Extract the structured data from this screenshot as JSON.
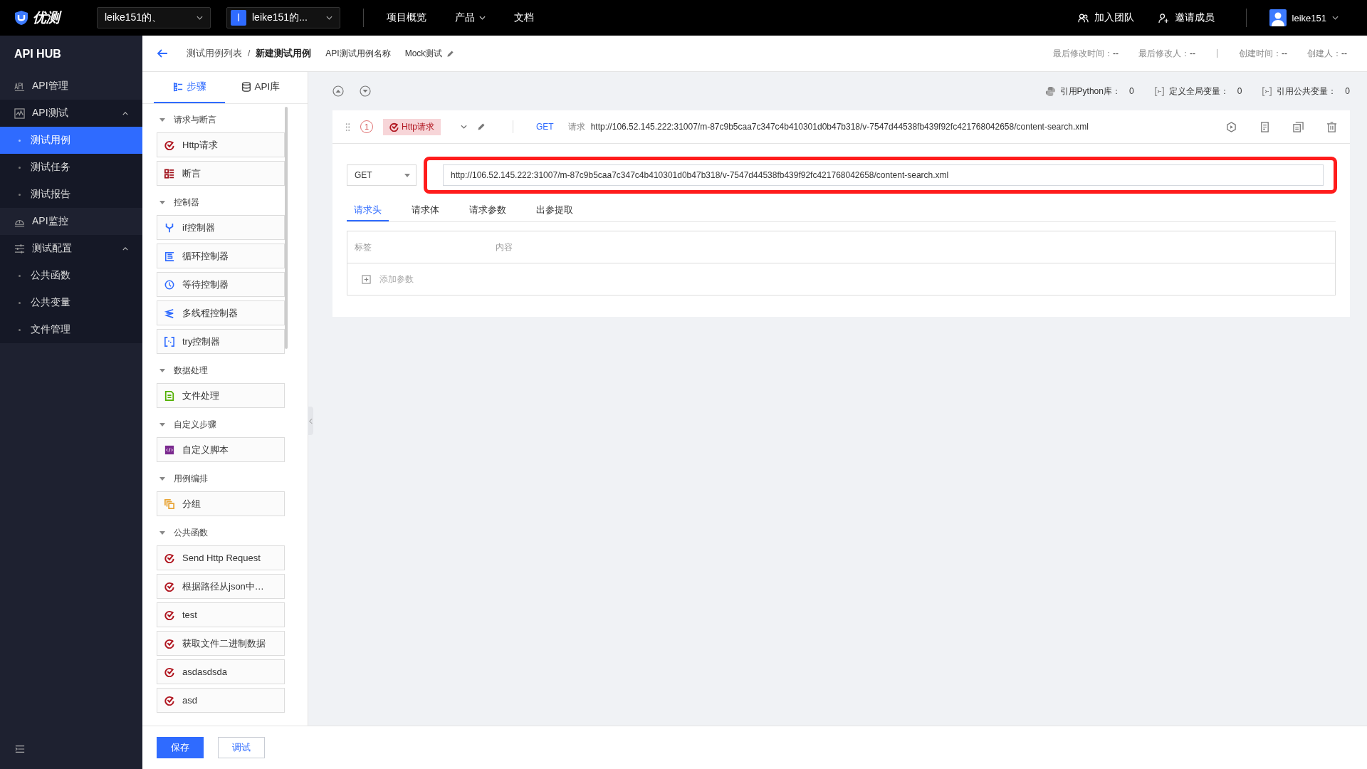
{
  "top_bar": {
    "logo": "优测",
    "team_select": "leike151的、",
    "project_select": {
      "badge": "l",
      "label": "leike151的..."
    },
    "nav": [
      {
        "label": "项目概览",
        "dropdown": false
      },
      {
        "label": "产品",
        "dropdown": true
      },
      {
        "label": "文档",
        "dropdown": false
      }
    ],
    "actions": [
      "加入团队",
      "邀请成员"
    ],
    "user": "leike151"
  },
  "sidebar": {
    "title": "API HUB",
    "items": [
      {
        "label": "API管理",
        "selected": false
      },
      {
        "label": "API测试",
        "selected": false,
        "expanded": true,
        "children": [
          {
            "label": "测试用例",
            "selected": true
          },
          {
            "label": "测试任务",
            "selected": false
          },
          {
            "label": "测试报告",
            "selected": false
          }
        ]
      },
      {
        "label": "API监控",
        "selected": false
      },
      {
        "label": "测试配置",
        "selected": false,
        "expanded": true,
        "children": [
          {
            "label": "公共函数",
            "selected": false
          },
          {
            "label": "公共变量",
            "selected": false
          },
          {
            "label": "文件管理",
            "selected": false
          }
        ]
      }
    ]
  },
  "header": {
    "breadcrumb": [
      "测试用例列表",
      "新建测试用例"
    ],
    "breadcrumb_separator": "/",
    "case_name": "API测试用例名称",
    "tag": "Mock测试",
    "meta": [
      {
        "label": "最后修改时间：",
        "value": "--"
      },
      {
        "label": "最后修改人：",
        "value": "--"
      },
      {
        "label": "创建时间：",
        "value": "--"
      },
      {
        "label": "创建人：",
        "value": "--"
      }
    ]
  },
  "steps_panel": {
    "tabs": [
      {
        "label": "步骤",
        "selected": true
      },
      {
        "label": "API库",
        "selected": false
      }
    ],
    "groups": [
      {
        "title": "请求与断言",
        "expanded": true,
        "items": [
          {
            "label": "Http请求",
            "kind": "http"
          },
          {
            "label": "断言",
            "kind": "assert"
          }
        ]
      },
      {
        "title": "控制器",
        "expanded": true,
        "items": [
          {
            "label": "if控制器",
            "kind": "if"
          },
          {
            "label": "循环控制器",
            "kind": "loop"
          },
          {
            "label": "等待控制器",
            "kind": "wait"
          },
          {
            "label": "多线程控制器",
            "kind": "thread"
          },
          {
            "label": "try控制器",
            "kind": "try"
          }
        ]
      },
      {
        "title": "数据处理",
        "expanded": true,
        "items": [
          {
            "label": "文件处理",
            "kind": "file"
          }
        ]
      },
      {
        "title": "自定义步骤",
        "expanded": true,
        "items": [
          {
            "label": "自定义脚本",
            "kind": "script"
          }
        ]
      },
      {
        "title": "用例编排",
        "expanded": true,
        "items": [
          {
            "label": "分组",
            "kind": "group"
          }
        ]
      },
      {
        "title": "公共函数",
        "expanded": true,
        "items": [
          {
            "label": "Send Http Request",
            "kind": "http"
          },
          {
            "label": "根据路径从json中…",
            "kind": "http"
          },
          {
            "label": "test",
            "kind": "http"
          },
          {
            "label": "获取文件二进制数据",
            "kind": "http"
          },
          {
            "label": "asdasdsda",
            "kind": "http"
          },
          {
            "label": "asd",
            "kind": "http"
          }
        ]
      }
    ]
  },
  "stats": [
    {
      "label": "引用Python库：",
      "value": "0",
      "kind": "python"
    },
    {
      "label": "定义全局变量：",
      "value": "0",
      "kind": "var"
    },
    {
      "label": "引用公共变量：",
      "value": "0",
      "kind": "var"
    }
  ],
  "step": {
    "number": "1",
    "type_tag": "Http请求",
    "method": "GET",
    "request_label": "请求",
    "url": "http://106.52.145.222:31007/m-87c9b5caa7c347c4b410301d0b47b318/v-7547d44538fb439f92fc421768042658/content-search.xml",
    "form": {
      "method": "GET",
      "url": "http://106.52.145.222:31007/m-87c9b5caa7c347c4b410301d0b47b318/v-7547d44538fb439f92fc421768042658/content-search.xml",
      "highlighted": true
    },
    "tabs": [
      {
        "label": "请求头",
        "selected": true
      },
      {
        "label": "请求体",
        "selected": false
      },
      {
        "label": "请求参数",
        "selected": false
      },
      {
        "label": "出参提取",
        "selected": false
      }
    ],
    "table": {
      "columns": [
        "标签",
        "内容"
      ],
      "add_row": "添加参数"
    }
  },
  "footer": {
    "buttons": [
      {
        "label": "保存",
        "kind": "primary"
      },
      {
        "label": "调试",
        "kind": "secondary"
      }
    ]
  }
}
